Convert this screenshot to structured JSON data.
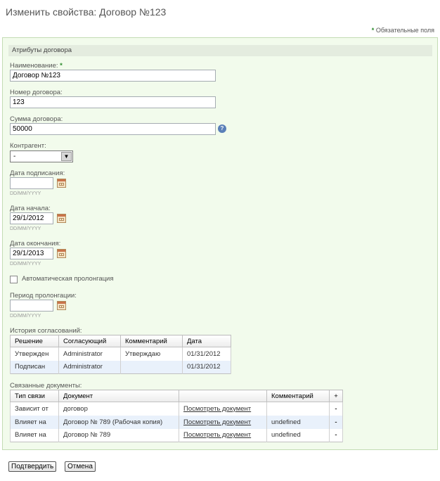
{
  "page": {
    "title": "Изменить свойства: Договор №123",
    "required_note": "Обязательные поля",
    "required_mark": "*"
  },
  "section": {
    "title": "Атрибуты договора"
  },
  "fields": {
    "name": {
      "label": "Наименование:",
      "value": "Договор №123"
    },
    "number": {
      "label": "Номер договора:",
      "value": "123"
    },
    "amount": {
      "label": "Сумма договора:",
      "value": "50000",
      "help_icon": "?"
    },
    "counterparty": {
      "label": "Контрагент:",
      "value": "-",
      "arrow": "▼"
    },
    "sign_date": {
      "label": "Дата подписания:",
      "value": "",
      "hint": "DD/MM/YYYY"
    },
    "start_date": {
      "label": "Дата начала:",
      "value": "29/1/2012",
      "hint": "DD/MM/YYYY"
    },
    "end_date": {
      "label": "Дата окончания:",
      "value": "29/1/2013",
      "hint": "DD/MM/YYYY"
    },
    "auto_prolong": {
      "label": "Автоматическая пролонгация",
      "checked": false
    },
    "prolong_period": {
      "label": "Период пролонгации:",
      "value": "",
      "hint": "DD/MM/YYYY"
    }
  },
  "approvals": {
    "label": "История согласований:",
    "columns": [
      "Решение",
      "Согласующий",
      "Комментарий",
      "Дата"
    ],
    "rows": [
      [
        "Утвержден",
        "Administrator",
        "Утверждаю",
        "01/31/2012"
      ],
      [
        "Подписан",
        "Administrator",
        "",
        "01/31/2012"
      ]
    ]
  },
  "related": {
    "label": "Связанные документы:",
    "columns": [
      "Тип связи",
      "Документ",
      "",
      "Комментарий",
      "+"
    ],
    "rows": [
      {
        "type": "Зависит от",
        "doc": "договор",
        "link": "Посмотреть документ",
        "comment": "",
        "remove": "-"
      },
      {
        "type": "Влияет на",
        "doc": "Договор № 789 (Рабочая копия)",
        "link": "Посмотреть документ",
        "comment": "undefined",
        "remove": "-"
      },
      {
        "type": "Влияет на",
        "doc": "Договор № 789",
        "link": "Посмотреть документ",
        "comment": "undefined",
        "remove": "-"
      }
    ]
  },
  "buttons": {
    "submit": "Подтвердить",
    "cancel": "Отмена"
  }
}
